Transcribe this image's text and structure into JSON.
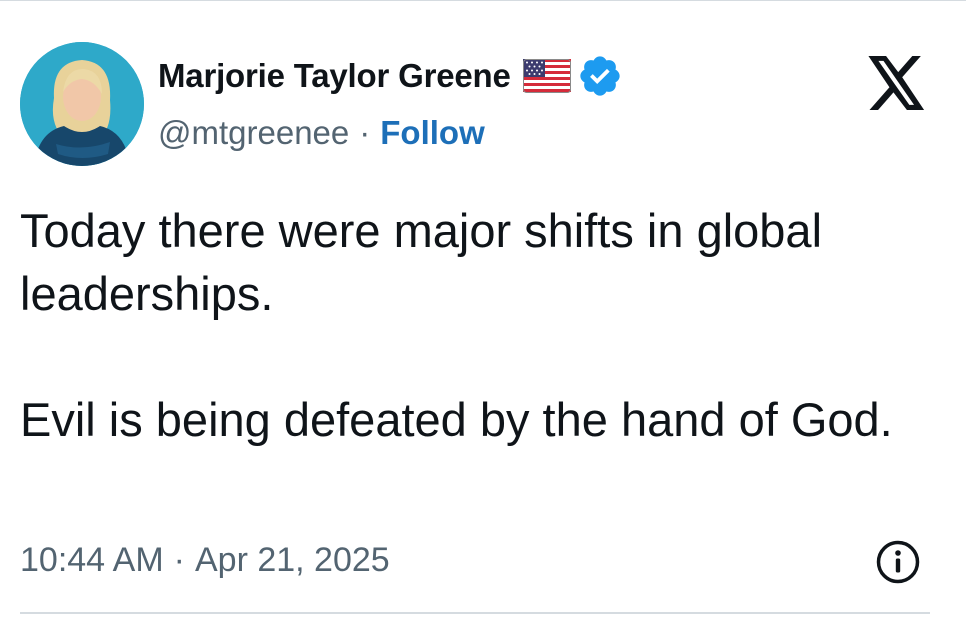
{
  "author": {
    "display_name": "Marjorie Taylor Greene",
    "handle": "@mtgreenee",
    "separator": "·",
    "follow_label": "Follow",
    "badge_flag_icon": "us-flag-icon",
    "verified_icon": "verified-badge-icon",
    "avatar_icon": "profile-avatar"
  },
  "logo_icon": "x-logo-icon",
  "tweet": {
    "text": "Today there were major shifts in global leaderships.\n\nEvil is being defeated by the hand of God.",
    "time": "10:44 AM",
    "separator": "·",
    "date": "Apr 21, 2025",
    "info_icon": "info-icon"
  },
  "colors": {
    "follow_link": "#1d6fb8",
    "verified_badge": "#1d9bf0",
    "secondary_text": "#536471",
    "primary_text": "#0f1419"
  }
}
